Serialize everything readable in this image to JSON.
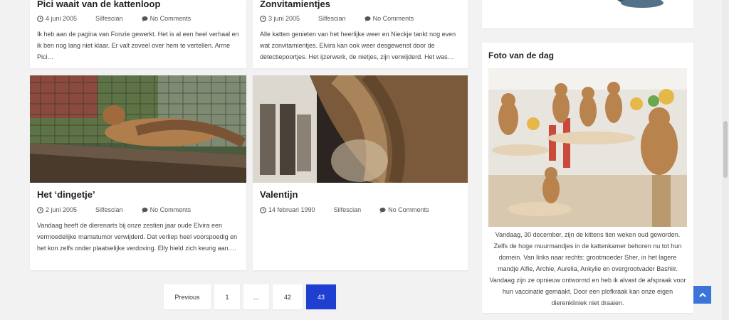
{
  "posts": [
    {
      "title": "Pici waait van de kattenloop",
      "date": "4 juni 2005",
      "author": "Silfescian",
      "comments": "No Comments",
      "excerpt": "Ik heb aan de pagina van Fonzie gewerkt. Het is al een heel verhaal en ik ben nog lang niet klaar. Er valt zoveel over hem te vertellen. Arme Pici…"
    },
    {
      "title": "Zonvitamientjes",
      "date": "3 juni 2005",
      "author": "Silfescian",
      "comments": "No Comments",
      "excerpt": "Alle katten genieten van het heerlijke weer en Nieckje tankt nog even wat zonvitamientjes. Elvira kan ook weer desgewenst door de detectiepoortjes. Het ijzerwerk, de nietjes, zijn verwijderd. Het was…"
    },
    {
      "title": "Het ‘dingetje’",
      "date": "2 juni 2005",
      "author": "Silfescian",
      "comments": "No Comments",
      "excerpt": "Vandaag heeft de dierenarts bij onze zestien jaar oude Elvira een vermoedelijke mamatumor verwijderd. Dat verliep heel voorspoedig en het kon zelfs onder plaatselijke verdoving. Elly hield zich keurig aan.…"
    },
    {
      "title": "Valentijn",
      "date": "14 februari 1990",
      "author": "Silfescian",
      "comments": "No Comments",
      "excerpt": ""
    }
  ],
  "pagination": {
    "previous": "Previous",
    "pages": [
      "1",
      "…",
      "42",
      "43"
    ],
    "current": "43"
  },
  "sidebar": {
    "photo_widget": {
      "title": "Foto van de dag",
      "caption": "Vandaag, 30 december, zijn de kittens tien weken oud geworden. Zelfs de hoge muurmandjes in de kattenkamer behoren nu tot hun domein. Van links naar rechts: grootmoeder Sher, in het lagere mandje Alfie, Archie, Aurelia, Ankylie en overgrootvader Bashiir. Vandaag zijn ze opnieuw ontwormd en heb ik alvast de afspraak voor hun vaccinatie gemaakt. Door een plofkraak kan onze eigen dierenkliniek niet draaien."
    }
  },
  "colors": {
    "accent": "#1e3fcf",
    "back_to_top": "#3b74d9",
    "page_bg": "#f2f2f2"
  },
  "icons": {
    "date": "clock-icon",
    "comments": "comment-icon",
    "back_to_top": "chevron-up-icon"
  }
}
